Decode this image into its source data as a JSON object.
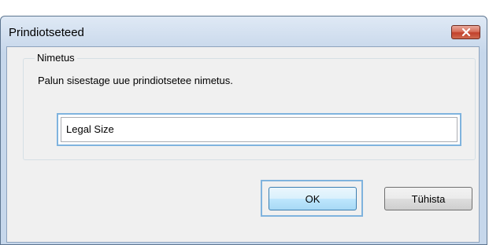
{
  "window": {
    "title": "Prindiotseteed",
    "close_icon": "close-icon"
  },
  "group": {
    "legend": "Nimetus",
    "prompt": "Palun sisestage uue prindiotsetee nimetus."
  },
  "name_field": {
    "value": "Legal Size"
  },
  "buttons": {
    "ok_label": "OK",
    "cancel_label": "Tühista"
  },
  "colors": {
    "title_gradient_top": "#dfe9f5",
    "client_bg": "#f0f0f0",
    "focus_ring": "#7fb3de",
    "close_button_red": "#c2412b"
  }
}
